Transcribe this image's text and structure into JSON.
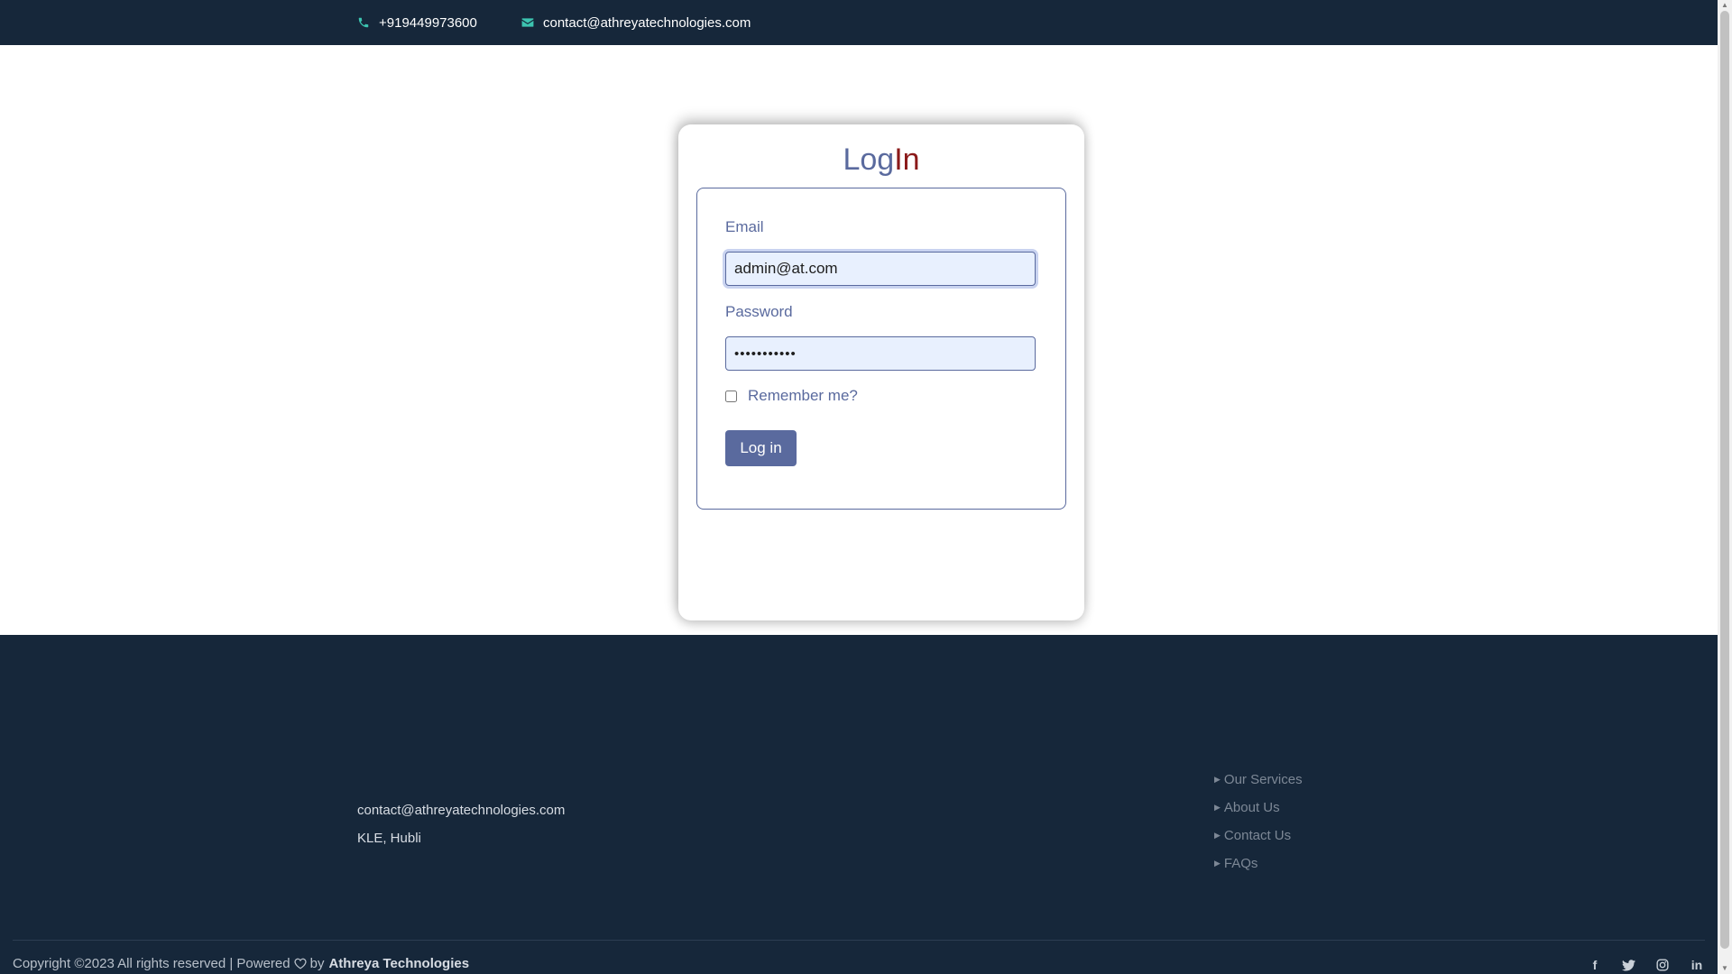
{
  "topbar": {
    "phone": "+919449973600",
    "email": "contact@athreyatechnologies.com",
    "phone_icon": "phone-icon",
    "email_icon": "envelope-icon"
  },
  "login": {
    "title_part1": "Log",
    "title_part2": "In",
    "email_label": "Email",
    "email_value": "admin@at.com",
    "password_label": "Password",
    "password_value": "•••••••••••",
    "remember_label": "Remember me?",
    "remember_checked": false,
    "submit_label": "Log in"
  },
  "footer": {
    "contact_email": "contact@athreyatechnologies.com",
    "location": "KLE, Hubli",
    "links": [
      "Our Services",
      "About Us",
      "Contact Us",
      "FAQs"
    ],
    "copyright_prefix": "Copyright ©2023 All rights reserved | Powered",
    "copyright_by": "by",
    "copyright_brand": "Athreya Technologies",
    "social_icons": [
      "facebook-icon",
      "twitter-icon",
      "instagram-icon",
      "linkedin-icon"
    ]
  },
  "colors": {
    "navy": "#16273a",
    "accent": "#5a6a9e",
    "title_in": "#8b1a1a",
    "icon_accent": "#3cc4b0"
  }
}
